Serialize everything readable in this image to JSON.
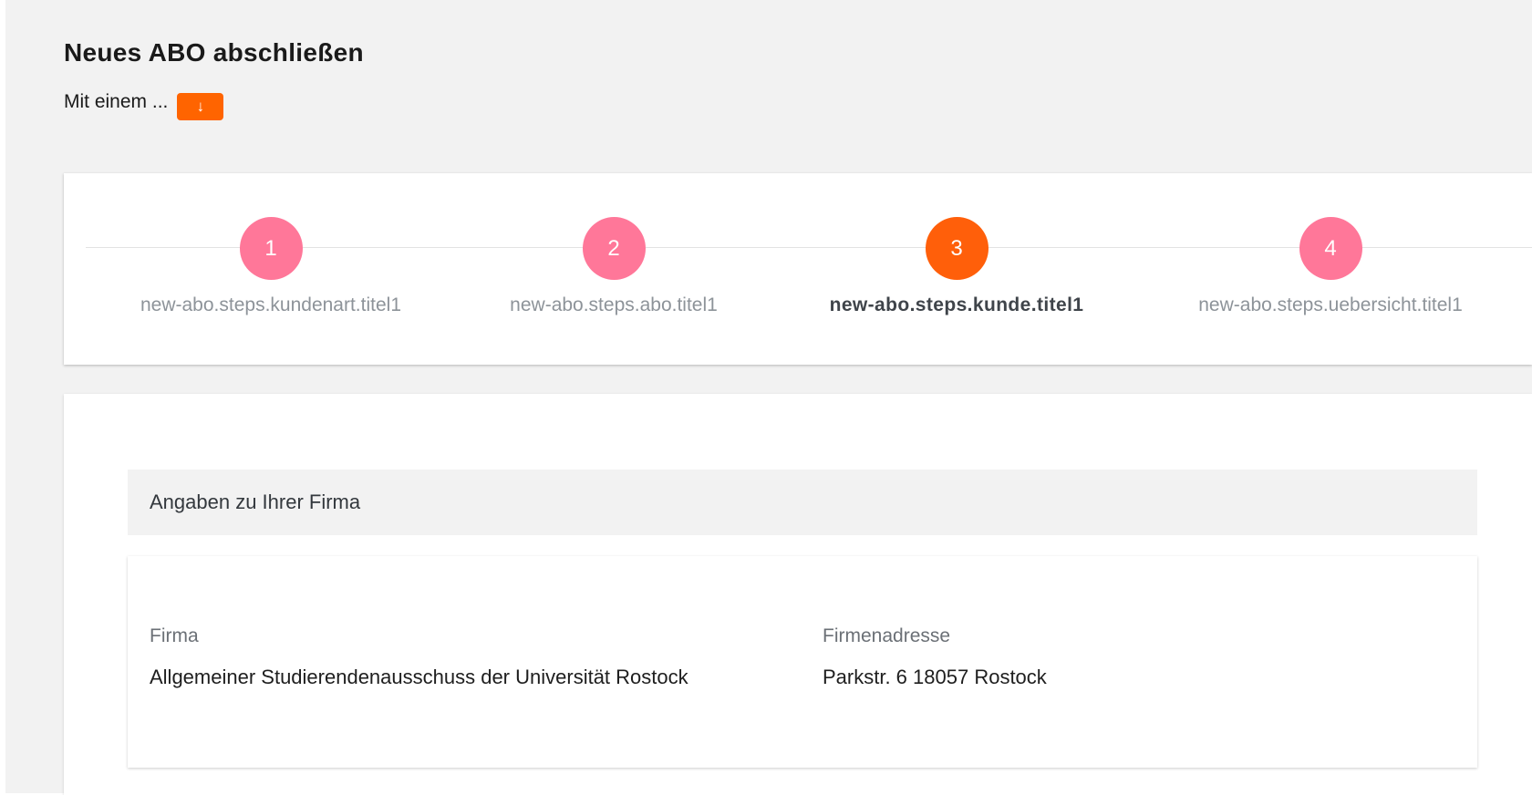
{
  "header": {
    "title": "Neues ABO abschließen",
    "subtitle": "Mit einem ...",
    "expand_button_icon": "↓"
  },
  "stepper": {
    "steps": [
      {
        "number": "1",
        "label": "new-abo.steps.kundenart.titel1",
        "state": "completed"
      },
      {
        "number": "2",
        "label": "new-abo.steps.abo.titel1",
        "state": "completed"
      },
      {
        "number": "3",
        "label": "new-abo.steps.kunde.titel1",
        "state": "active"
      },
      {
        "number": "4",
        "label": "new-abo.steps.uebersicht.titel1",
        "state": "upcoming"
      }
    ]
  },
  "company_section": {
    "title": "Angaben zu Ihrer Firma",
    "fields": [
      {
        "label": "Firma",
        "value": "Allgemeiner Studierendenausschuss der Universität Rostock"
      },
      {
        "label": "Firmenadresse",
        "value": "Parkstr. 6 18057 Rostock"
      }
    ]
  },
  "colors": {
    "accent": "#ff6400",
    "step_done": "#ff7799",
    "step_active": "#ff5f0a",
    "background": "#f2f2f2"
  },
  "icons": {
    "expand": "arrow-down-icon"
  }
}
